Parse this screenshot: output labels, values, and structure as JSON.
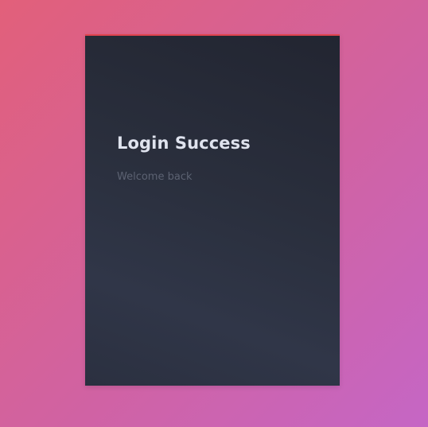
{
  "card": {
    "title": "Login Success",
    "subtitle": "Welcome back"
  },
  "colors": {
    "background_start": "#e2607a",
    "background_end": "#c566c5",
    "card_background": "#2a2f3d",
    "accent_bar": "#e0444f",
    "title_text": "#dfe3ee",
    "subtitle_text": "#5c6272"
  }
}
